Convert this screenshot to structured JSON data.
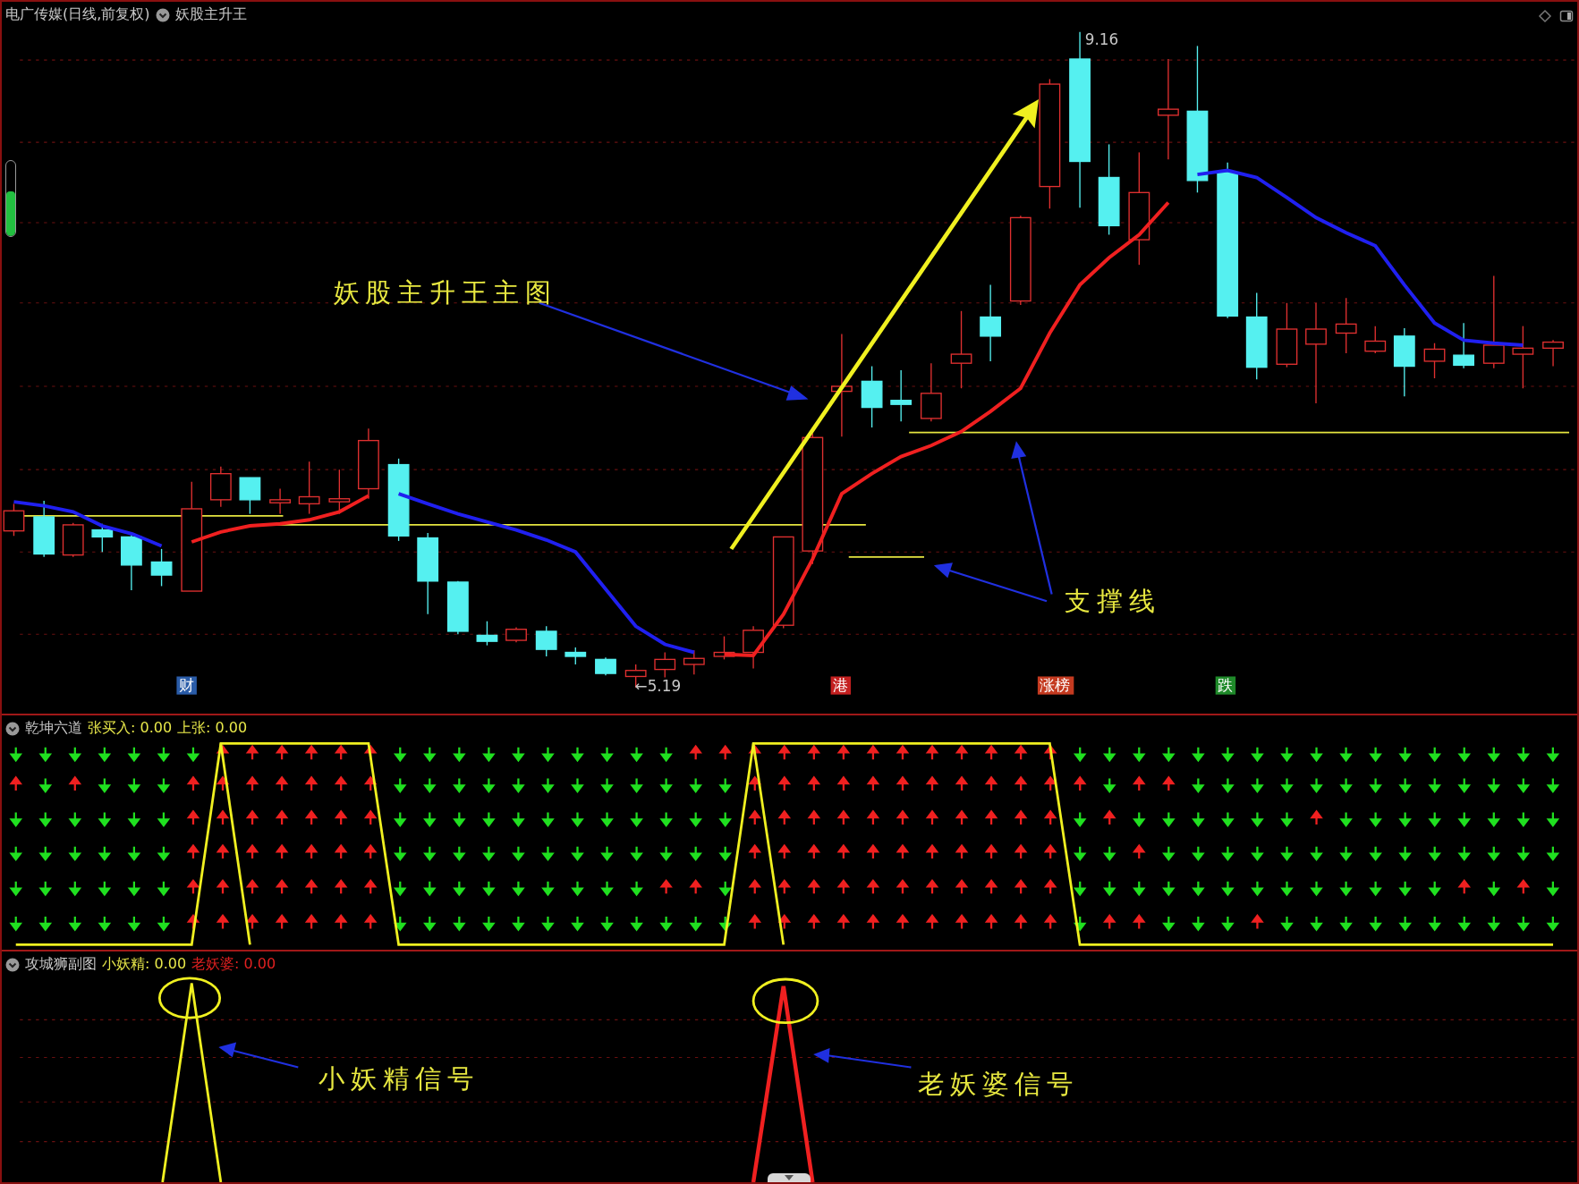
{
  "title_bar": {
    "stock": "电广传媒(日线,前复权)",
    "indicator": "妖股主升王"
  },
  "side_meter": {
    "level": 0.6
  },
  "main_chart": {
    "high_label": "9.16",
    "low_label": "←5.19",
    "annotations": [
      {
        "text": "妖股主升王主图"
      },
      {
        "text": "支撑线"
      }
    ],
    "event_tags": [
      {
        "text": "财",
        "color": "#2a5ca8"
      },
      {
        "text": "港",
        "color": "#c42020"
      },
      {
        "text": "涨榜",
        "color": "#c43a20"
      },
      {
        "text": "跌",
        "color": "#1f8a2a"
      }
    ]
  },
  "indicator_panel": {
    "name": "乾坤六道",
    "values": [
      {
        "text": "张买入: 0.00",
        "color": "#e8e84a"
      },
      {
        "text": "上张: 0.00",
        "color": "#e8e84a"
      }
    ]
  },
  "signal_panel": {
    "name": "攻城狮副图",
    "values": [
      {
        "text": "小妖精: 0.00",
        "color": "#e8e84a"
      },
      {
        "text": "老妖婆: 0.00",
        "color": "#e02020"
      }
    ],
    "annotations": [
      {
        "text": "小妖精信号"
      },
      {
        "text": "老妖婆信号"
      }
    ]
  }
}
